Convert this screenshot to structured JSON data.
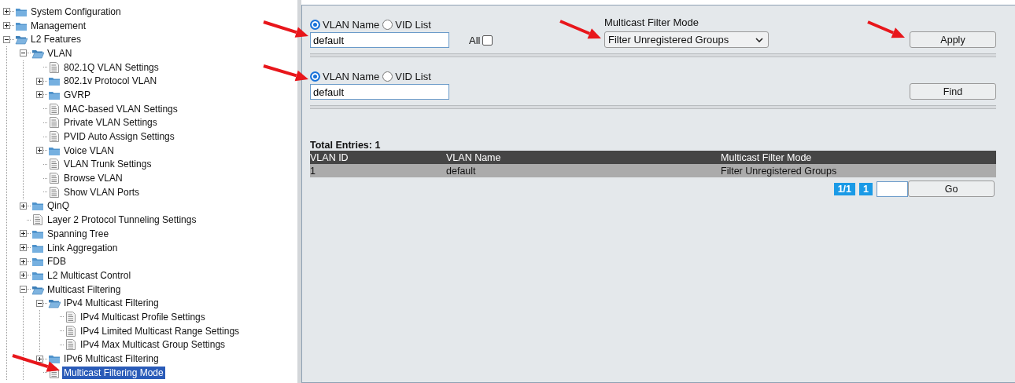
{
  "tree": [
    {
      "kind": "folder",
      "label": "System Configuration",
      "expanded": false,
      "selected": false
    },
    {
      "kind": "folder",
      "label": "Management",
      "expanded": false,
      "selected": false
    },
    {
      "kind": "folder",
      "label": "L2 Features",
      "expanded": true,
      "selected": false,
      "children": [
        {
          "kind": "folder",
          "label": "VLAN",
          "expanded": true,
          "selected": false,
          "children": [
            {
              "kind": "page",
              "label": "802.1Q VLAN Settings",
              "selected": false
            },
            {
              "kind": "folder",
              "label": "802.1v Protocol VLAN",
              "expanded": false,
              "selected": false
            },
            {
              "kind": "folder",
              "label": "GVRP",
              "expanded": false,
              "selected": false
            },
            {
              "kind": "page",
              "label": "MAC-based VLAN Settings",
              "selected": false
            },
            {
              "kind": "page",
              "label": "Private VLAN Settings",
              "selected": false
            },
            {
              "kind": "page",
              "label": "PVID Auto Assign Settings",
              "selected": false
            },
            {
              "kind": "folder",
              "label": "Voice VLAN",
              "expanded": false,
              "selected": false
            },
            {
              "kind": "page",
              "label": "VLAN Trunk Settings",
              "selected": false
            },
            {
              "kind": "page",
              "label": "Browse VLAN",
              "selected": false
            },
            {
              "kind": "page",
              "label": "Show VLAN Ports",
              "selected": false
            }
          ]
        },
        {
          "kind": "folder",
          "label": "QinQ",
          "expanded": false,
          "selected": false
        },
        {
          "kind": "page",
          "label": "Layer 2 Protocol Tunneling Settings",
          "selected": false
        },
        {
          "kind": "folder",
          "label": "Spanning Tree",
          "expanded": false,
          "selected": false
        },
        {
          "kind": "folder",
          "label": "Link Aggregation",
          "expanded": false,
          "selected": false
        },
        {
          "kind": "folder",
          "label": "FDB",
          "expanded": false,
          "selected": false
        },
        {
          "kind": "folder",
          "label": "L2 Multicast Control",
          "expanded": false,
          "selected": false
        },
        {
          "kind": "folder",
          "label": "Multicast Filtering",
          "expanded": true,
          "selected": false,
          "children": [
            {
              "kind": "folder",
              "label": "IPv4 Multicast Filtering",
              "expanded": true,
              "selected": false,
              "children": [
                {
                  "kind": "page",
                  "label": "IPv4 Multicast Profile Settings",
                  "selected": false
                },
                {
                  "kind": "page",
                  "label": "IPv4 Limited Multicast Range Settings",
                  "selected": false
                },
                {
                  "kind": "page",
                  "label": "IPv4 Max Multicast Group Settings",
                  "selected": false
                }
              ]
            },
            {
              "kind": "folder",
              "label": "IPv6 Multicast Filtering",
              "expanded": false,
              "selected": false
            },
            {
              "kind": "page",
              "label": "Multicast Filtering Mode",
              "selected": true
            }
          ]
        }
      ]
    }
  ],
  "filter_form": {
    "scope_options": [
      {
        "label": "VLAN Name",
        "selected": true
      },
      {
        "label": "VID List",
        "selected": false
      }
    ],
    "vlan_field": {
      "value": "default"
    },
    "all_checkbox": {
      "label": "All",
      "checked": false
    },
    "mode_label": "Multicast Filter Mode",
    "mode_select": {
      "value": "Filter Unregistered Groups"
    },
    "apply_button": "Apply"
  },
  "find_form": {
    "scope_options": [
      {
        "label": "VLAN Name",
        "selected": true
      },
      {
        "label": "VID List",
        "selected": false
      }
    ],
    "vlan_field": {
      "value": "default"
    },
    "find_button": "Find"
  },
  "results": {
    "total": "Total Entries: 1",
    "columns": [
      "VLAN ID",
      "VLAN Name",
      "Multicast Filter Mode"
    ],
    "rows": [
      [
        "1",
        "default",
        "Filter Unregistered Groups"
      ]
    ]
  },
  "pagination": {
    "page_info": "1/1",
    "pages": [
      "1"
    ],
    "go_button": "Go"
  }
}
